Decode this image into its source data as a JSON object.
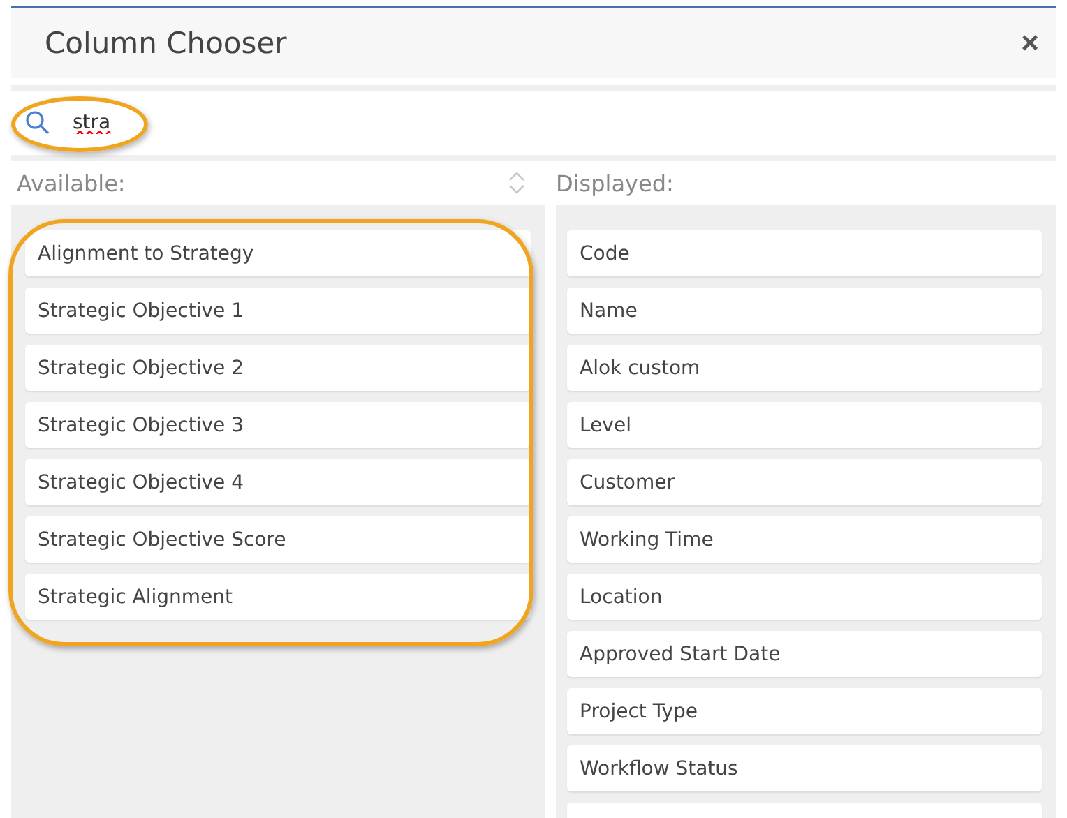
{
  "window": {
    "title": "Column Chooser",
    "close": "×"
  },
  "search": {
    "value": "stra"
  },
  "available": {
    "label": "Available:",
    "items": [
      {
        "label": "Alignment to Strategy"
      },
      {
        "label": "Strategic Objective 1"
      },
      {
        "label": "Strategic Objective 2"
      },
      {
        "label": "Strategic Objective 3"
      },
      {
        "label": "Strategic Objective 4"
      },
      {
        "label": "Strategic Objective Score"
      },
      {
        "label": "Strategic Alignment"
      }
    ]
  },
  "displayed": {
    "label": "Displayed:",
    "items": [
      {
        "label": "Code"
      },
      {
        "label": "Name"
      },
      {
        "label": "Alok custom"
      },
      {
        "label": "Level"
      },
      {
        "label": "Customer"
      },
      {
        "label": "Working Time"
      },
      {
        "label": "Location"
      },
      {
        "label": "Approved Start Date"
      },
      {
        "label": "Project Type"
      },
      {
        "label": "Workflow Status"
      }
    ]
  }
}
